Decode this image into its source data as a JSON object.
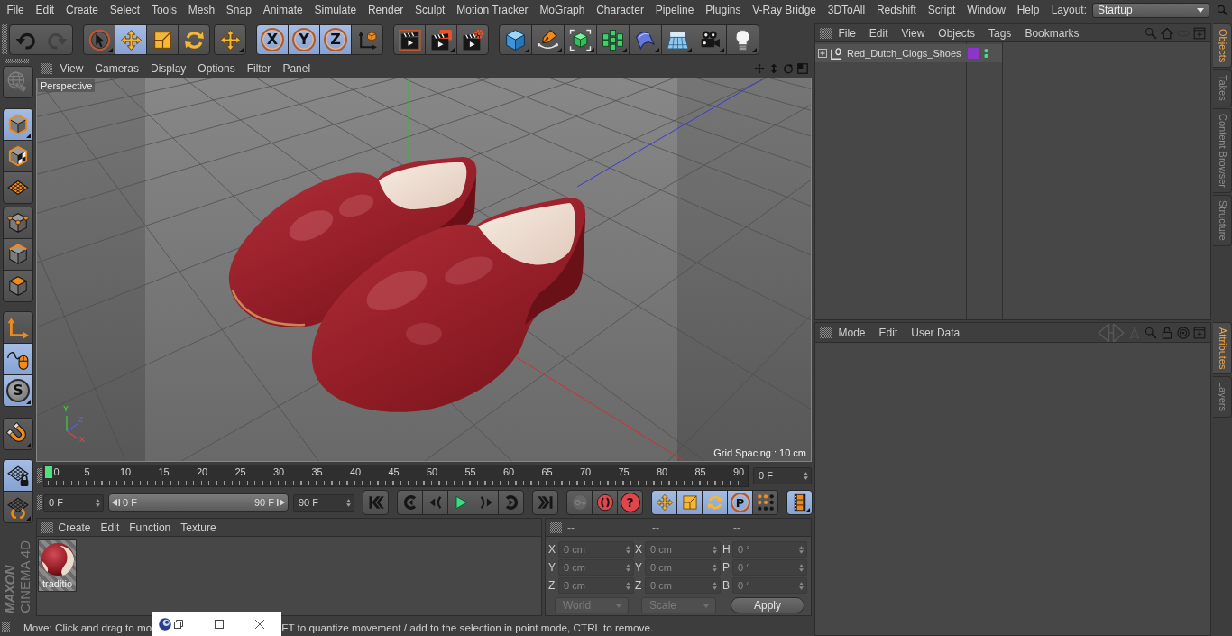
{
  "menu_bar": {
    "items": [
      "File",
      "Edit",
      "Create",
      "Select",
      "Tools",
      "Mesh",
      "Snap",
      "Animate",
      "Simulate",
      "Render",
      "Sculpt",
      "Motion Tracker",
      "MoGraph",
      "Character",
      "Pipeline",
      "Plugins",
      "V-Ray Bridge",
      "3DToAll",
      "Redshift",
      "Script",
      "Window",
      "Help"
    ],
    "layout_label": "Layout:",
    "layout_value": "Startup"
  },
  "toolbar": {
    "groups": [
      [
        {
          "kind": "undo",
          "selected": false,
          "disabled": false,
          "submenu": false
        },
        {
          "kind": "redo",
          "selected": false,
          "disabled": true,
          "submenu": false
        }
      ],
      [
        {
          "kind": "live-select",
          "selected": false,
          "disabled": false,
          "submenu": true
        },
        {
          "kind": "move",
          "selected": true,
          "disabled": false,
          "submenu": false
        },
        {
          "kind": "scale",
          "selected": false,
          "disabled": false,
          "submenu": false
        },
        {
          "kind": "rotate",
          "selected": false,
          "disabled": false,
          "submenu": false
        }
      ],
      [
        {
          "kind": "move",
          "selected": false,
          "disabled": false,
          "submenu": true
        }
      ],
      [
        {
          "kind": "axis-letter",
          "label": "X",
          "selected": true,
          "disabled": false,
          "submenu": false
        },
        {
          "kind": "axis-letter",
          "label": "Y",
          "selected": true,
          "disabled": false,
          "submenu": false
        },
        {
          "kind": "axis-letter",
          "label": "Z",
          "selected": true,
          "disabled": false,
          "submenu": false
        },
        {
          "kind": "coordinate-system",
          "selected": false,
          "disabled": false,
          "submenu": false
        }
      ],
      [
        {
          "kind": "render-view",
          "selected": false,
          "disabled": false,
          "submenu": false
        },
        {
          "kind": "render-picture-viewer",
          "selected": false,
          "disabled": false,
          "submenu": true
        },
        {
          "kind": "render-settings",
          "selected": false,
          "disabled": false,
          "submenu": false
        }
      ],
      [
        {
          "kind": "cube",
          "selected": false,
          "disabled": false,
          "submenu": true
        },
        {
          "kind": "pen",
          "selected": false,
          "disabled": false,
          "submenu": true
        },
        {
          "kind": "subdivision",
          "selected": false,
          "disabled": false,
          "submenu": true
        },
        {
          "kind": "cloner",
          "selected": false,
          "disabled": false,
          "submenu": true
        },
        {
          "kind": "deformer",
          "selected": false,
          "disabled": false,
          "submenu": true
        },
        {
          "kind": "floor",
          "selected": false,
          "disabled": false,
          "submenu": true
        },
        {
          "kind": "camera",
          "selected": false,
          "disabled": false,
          "submenu": true
        },
        {
          "kind": "light",
          "selected": false,
          "disabled": false,
          "submenu": true
        }
      ]
    ]
  },
  "mode_toolbar": {
    "groups": [
      [
        {
          "kind": "model",
          "selected": false,
          "disabled": true,
          "submenu": false
        }
      ],
      [
        {
          "kind": "object",
          "selected": true,
          "disabled": false,
          "submenu": true
        },
        {
          "kind": "texture",
          "selected": false,
          "disabled": false,
          "submenu": false
        },
        {
          "kind": "workplane",
          "selected": false,
          "disabled": false,
          "submenu": false
        }
      ],
      [
        {
          "kind": "points",
          "selected": false,
          "disabled": false,
          "submenu": false
        },
        {
          "kind": "edges",
          "selected": false,
          "disabled": false,
          "submenu": false
        },
        {
          "kind": "polygons",
          "selected": false,
          "disabled": false,
          "submenu": false
        }
      ],
      [
        {
          "kind": "axis",
          "selected": false,
          "disabled": false,
          "submenu": false
        },
        {
          "kind": "tweak",
          "selected": true,
          "disabled": false,
          "submenu": false
        },
        {
          "kind": "snap-letter",
          "label": "S",
          "selected": true,
          "disabled": false,
          "submenu": true
        }
      ],
      [
        {
          "kind": "magnet",
          "selected": false,
          "disabled": false,
          "submenu": true
        }
      ],
      [
        {
          "kind": "grid-lock",
          "selected": true,
          "disabled": false,
          "submenu": false
        },
        {
          "kind": "grid-rotate",
          "selected": false,
          "disabled": false,
          "submenu": true
        }
      ]
    ]
  },
  "logo": {
    "brand": "MAXON",
    "product": "CINEMA 4D"
  },
  "viewport": {
    "menu": [
      "View",
      "Cameras",
      "Display",
      "Options",
      "Filter",
      "Panel"
    ],
    "camera": "Perspective",
    "grid_spacing": "Grid Spacing : 10 cm",
    "axes": [
      {
        "label": "Y",
        "color": "#3cc43c"
      },
      {
        "label": "Z",
        "color": "#5060e0"
      },
      {
        "label": "X",
        "color": "#e04040"
      }
    ]
  },
  "timeline": {
    "frames": [
      "0",
      "5",
      "10",
      "15",
      "20",
      "25",
      "30",
      "35",
      "40",
      "45",
      "50",
      "55",
      "60",
      "65",
      "70",
      "75",
      "80",
      "85",
      "90"
    ],
    "level": 0,
    "current_frame": "0 F"
  },
  "transport": {
    "start_frame": "0 F",
    "range": {
      "start": "0 F",
      "end": "90 F"
    },
    "end_frame": "90 F",
    "groups": [
      [
        {
          "kind": "go-start",
          "selected": false,
          "disabled": false,
          "submenu": false
        }
      ],
      [
        {
          "kind": "prev-key",
          "selected": false,
          "disabled": false,
          "submenu": false
        },
        {
          "kind": "prev-frame",
          "selected": false,
          "disabled": false,
          "submenu": false
        },
        {
          "kind": "play",
          "selected": false,
          "disabled": false,
          "submenu": false
        },
        {
          "kind": "next-frame",
          "selected": false,
          "disabled": false,
          "submenu": false
        },
        {
          "kind": "next-key",
          "selected": false,
          "disabled": false,
          "submenu": false
        }
      ],
      [
        {
          "kind": "go-end",
          "selected": false,
          "disabled": false,
          "submenu": false
        }
      ],
      [
        {
          "kind": "key",
          "selected": false,
          "disabled": true,
          "submenu": false
        },
        {
          "kind": "record",
          "selected": false,
          "disabled": false,
          "submenu": false
        },
        {
          "kind": "help-letter",
          "label": "?",
          "selected": false,
          "disabled": false,
          "submenu": false
        }
      ],
      [
        {
          "kind": "move",
          "selected": true,
          "disabled": false,
          "submenu": false
        },
        {
          "kind": "scale",
          "selected": true,
          "disabled": false,
          "submenu": false
        },
        {
          "kind": "rotate",
          "selected": true,
          "disabled": false,
          "submenu": false
        },
        {
          "kind": "param-letter",
          "label": "P",
          "selected": true,
          "disabled": false,
          "submenu": false
        },
        {
          "kind": "dots",
          "selected": false,
          "disabled": false,
          "submenu": false
        }
      ],
      [
        {
          "kind": "film",
          "selected": true,
          "disabled": false,
          "submenu": true
        }
      ]
    ]
  },
  "material_manager": {
    "menu": [
      "Create",
      "Edit",
      "Function",
      "Texture"
    ],
    "materials": [
      {
        "name": "traditio"
      }
    ]
  },
  "coordinates": {
    "disabled": true,
    "headers": [
      "--",
      "--",
      "--"
    ],
    "rows": [
      {
        "position_label": "X",
        "position": "0 cm",
        "size_label": "X",
        "size": "0 cm",
        "rotation_label": "H",
        "rotation": "0 °"
      },
      {
        "position_label": "Y",
        "position": "0 cm",
        "size_label": "Y",
        "size": "0 cm",
        "rotation_label": "P",
        "rotation": "0 °"
      },
      {
        "position_label": "Z",
        "position": "0 cm",
        "size_label": "Z",
        "size": "0 cm",
        "rotation_label": "B",
        "rotation": "0 °"
      }
    ],
    "mode": "World",
    "size_mode": "Scale",
    "apply": "Apply"
  },
  "status_bar": {
    "texts": [
      "Move: Click and drag to mo",
      "FT to quantize movement / add to the selection in point mode, CTRL to remove."
    ]
  },
  "objects_manager": {
    "menu": [
      "File",
      "Edit",
      "View",
      "Objects",
      "Tags",
      "Bookmarks"
    ],
    "tools": [
      {
        "kind": "search",
        "disabled": false
      },
      {
        "kind": "home",
        "disabled": false
      },
      {
        "kind": "eye",
        "disabled": true
      },
      {
        "kind": "new-panel",
        "disabled": false
      }
    ],
    "objects": [
      {
        "name": "Red_Dutch_Clogs_Shoes",
        "expanded": false,
        "color": "#8b36c8"
      }
    ]
  },
  "attributes_manager": {
    "menu": [
      "Mode",
      "Edit",
      "User Data"
    ],
    "tools": [
      {
        "kind": "history",
        "disabled": true
      },
      {
        "kind": "up",
        "disabled": true
      },
      {
        "kind": "search",
        "disabled": false
      },
      {
        "kind": "lock",
        "disabled": false
      },
      {
        "kind": "target",
        "disabled": false
      },
      {
        "kind": "new-panel",
        "disabled": false
      }
    ]
  },
  "side_tabs": {
    "objects_dock": [
      {
        "label": "Objects",
        "selected": true
      },
      {
        "label": "Takes",
        "selected": false
      },
      {
        "label": "Content Browser",
        "selected": false
      },
      {
        "label": "Structure",
        "selected": false
      }
    ],
    "attributes_dock": [
      {
        "label": "Attributes",
        "selected": true
      },
      {
        "label": "Layers",
        "selected": false
      }
    ]
  }
}
